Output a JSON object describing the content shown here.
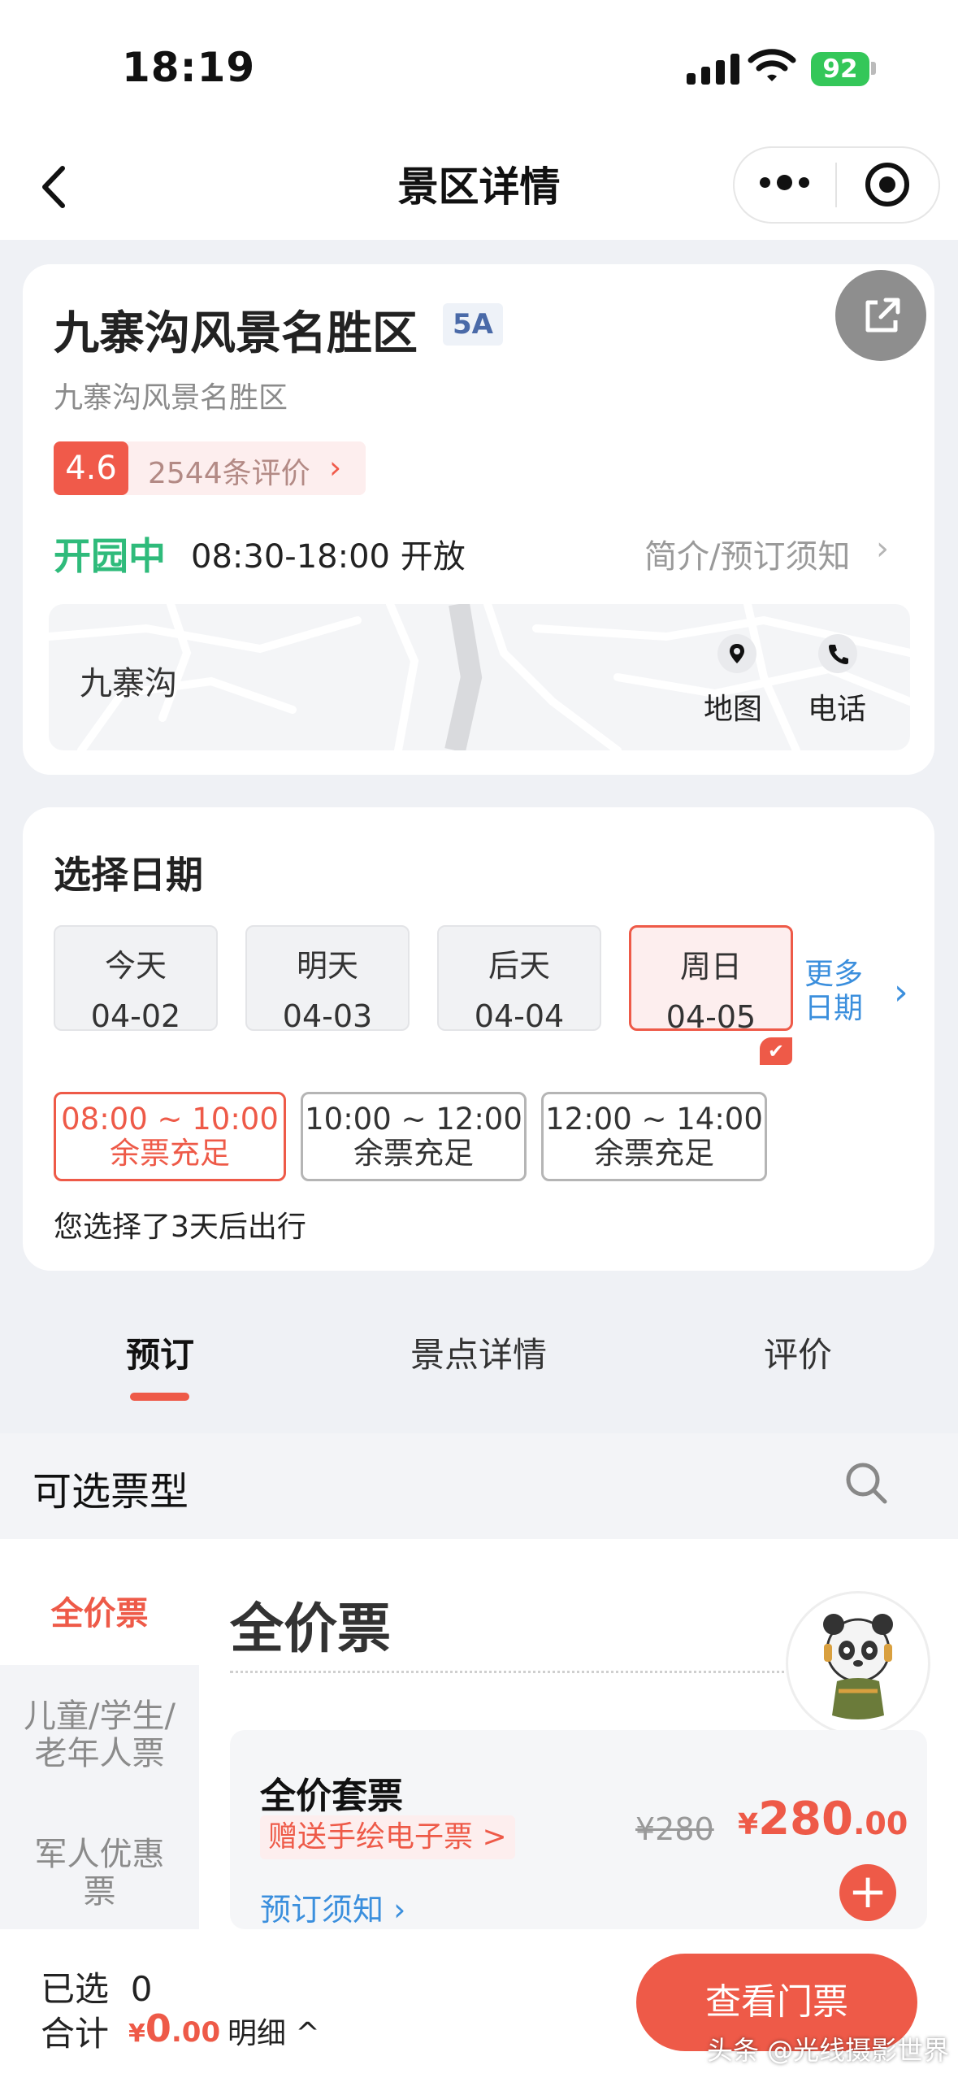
{
  "status_bar": {
    "time": "18:19",
    "battery": "92"
  },
  "nav": {
    "title": "景区详情"
  },
  "scenic": {
    "name": "九寨沟风景名胜区",
    "grade": "5A",
    "subtitle": "九寨沟风景名胜区",
    "rating": "4.6",
    "review_count": "2544条评价",
    "status": "开园中",
    "hours": "08:30-18:00 开放",
    "intro_link": "简介/预订须知",
    "map_location": "九寨沟",
    "map_label": "地图",
    "phone_label": "电话"
  },
  "date_select": {
    "title": "选择日期",
    "dates": [
      {
        "label": "今天",
        "date": "04-02"
      },
      {
        "label": "明天",
        "date": "04-03"
      },
      {
        "label": "后天",
        "date": "04-04"
      },
      {
        "label": "周日",
        "date": "04-05"
      }
    ],
    "selected_index": 3,
    "more_line1": "更多",
    "more_line2": "日期",
    "slots": [
      {
        "time": "08:00 ~ 10:00",
        "status": "余票充足"
      },
      {
        "time": "10:00 ~ 12:00",
        "status": "余票充足"
      },
      {
        "time": "12:00 ~ 14:00",
        "status": "余票充足"
      }
    ],
    "note": "您选择了3天后出行"
  },
  "tabs": [
    {
      "label": "预订"
    },
    {
      "label": "景点详情"
    },
    {
      "label": "评价"
    }
  ],
  "ticket_types": {
    "title": "可选票型",
    "side_items": [
      {
        "label": "全价票"
      },
      {
        "label": "儿童/学生/老年人票"
      },
      {
        "label": "军人优惠票"
      }
    ],
    "section_title": "全价票",
    "ticket": {
      "name": "全价套票",
      "gift": "赠送手绘电子票 >",
      "note": "预订须知",
      "old_price": "¥280",
      "currency": "¥",
      "price_int": "280",
      "price_dec": ".00"
    }
  },
  "bottom_bar": {
    "selected_label": "已选",
    "selected_count": "0",
    "total_label": "合计",
    "currency": "¥",
    "total_int": "0",
    "total_dec": ".00",
    "detail": "明细",
    "button": "查看门票"
  },
  "watermark": "头条 @光线摄影世界",
  "colors": {
    "accent": "#ee5a48",
    "open_green": "#2fbb7b",
    "link_blue": "#3b8fdd"
  }
}
